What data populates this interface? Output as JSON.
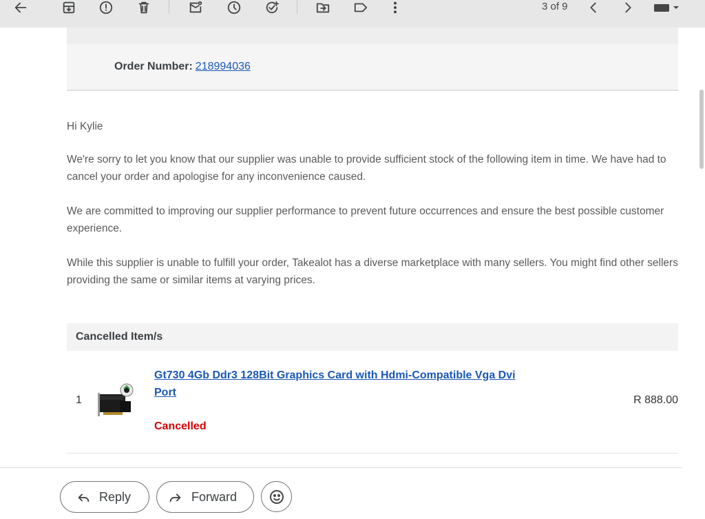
{
  "toolbar": {
    "pager_text": "3 of 9",
    "icons": [
      "back-arrow-icon",
      "archive-icon",
      "report-spam-icon",
      "delete-icon",
      "mark-unread-icon",
      "snooze-icon",
      "add-task-icon",
      "move-to-icon",
      "label-icon",
      "more-icon",
      "prev-icon",
      "next-icon",
      "keyboard-icon"
    ]
  },
  "order": {
    "label": "Order Number:",
    "number": "218994036"
  },
  "body": {
    "greeting": "Hi Kylie",
    "p1": "We're sorry to let you know that our supplier was unable to provide sufficient stock of the following item in time. We have had to cancel your order and apologise for any inconvenience caused.",
    "p2": "We are committed to improving our supplier performance to prevent future occurrences and ensure the best possible customer experience.",
    "p3": "While this supplier is unable to fulfill your order, Takealot has a diverse marketplace with many sellers. You might find other sellers providing the same or similar items at varying prices."
  },
  "cancelled": {
    "heading": "Cancelled Item/s",
    "items": [
      {
        "qty": "1",
        "title": "Gt730 4Gb Ddr3 128Bit Graphics Card with Hdmi-Compatible Vga Dvi Port",
        "status": "Cancelled",
        "price": "R 888.00"
      }
    ]
  },
  "actions": {
    "reply": "Reply",
    "forward": "Forward"
  },
  "colors": {
    "link": "#1a57b8",
    "cancelled": "#d50000",
    "toolbar_bg": "#e7e7e8"
  }
}
